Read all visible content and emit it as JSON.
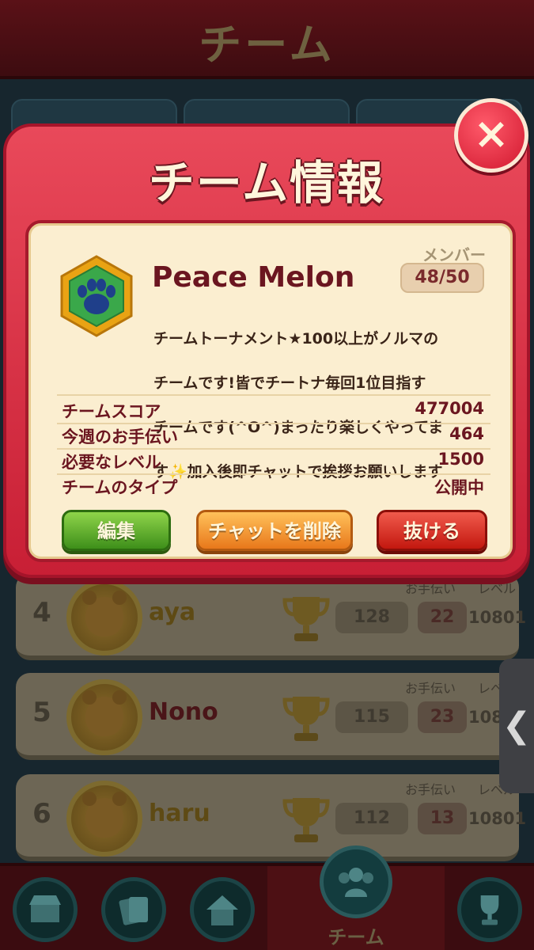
{
  "screen": {
    "header_title": "チーム"
  },
  "members": [
    {
      "rank": "4",
      "name": "aya",
      "score": "128",
      "help_label": "お手伝い",
      "level_label": "レベル",
      "help": "22",
      "level": "10801"
    },
    {
      "rank": "5",
      "name": "Nono",
      "score": "115",
      "help_label": "お手伝い",
      "level_label": "レベル",
      "help": "23",
      "level": "1080"
    },
    {
      "rank": "6",
      "name": "haru",
      "score": "112",
      "help_label": "お手伝い",
      "level_label": "レベル",
      "help": "13",
      "level": "10801"
    }
  ],
  "modal": {
    "title": "チーム情報",
    "close_label": "×",
    "team_name": "Peace Melon",
    "member_label": "メンバー",
    "member_count": "48/50",
    "description": [
      "チームトーナメント★100以上がノルマの",
      "チームです!皆でチートナ毎回1位目指す",
      "チームです(^O^)まったり楽しくやってま",
      "す✨加入後即チャットで挨拶お願いします"
    ],
    "stats": [
      {
        "label": "チームスコア",
        "value": "477004"
      },
      {
        "label": "今週のお手伝い",
        "value": "464"
      },
      {
        "label": "必要なレベル",
        "value": "1500"
      },
      {
        "label": "チームのタイプ",
        "value": "公開中"
      }
    ],
    "buttons": {
      "edit": "編集",
      "delete_chat": "チャットを削除",
      "leave": "抜ける"
    }
  },
  "nav": {
    "active_label": "チーム",
    "items": [
      "shop-icon",
      "cards-icon",
      "home-icon",
      "team-icon",
      "trophy-icon"
    ]
  },
  "colors": {
    "modal_red": "#d9283d",
    "panel_cream": "#fbeed0",
    "text_maroon": "#6b1620",
    "edit_green": "#5ab82a",
    "chat_orange": "#f29a30",
    "leave_red": "#d82a1c"
  }
}
